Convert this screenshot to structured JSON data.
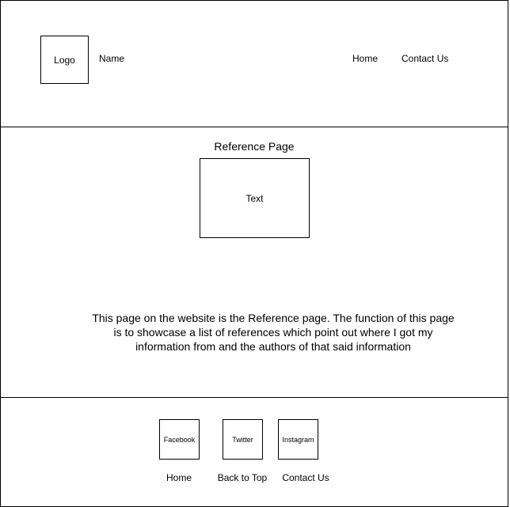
{
  "header": {
    "logo_label": "Logo",
    "site_name": "Name",
    "nav": {
      "home": "Home",
      "contact": "Contact Us"
    }
  },
  "main": {
    "title": "Reference Page",
    "text_box_label": "Text",
    "description": "This page on the website is the Reference page. The function of this page is to showcase a list of references which point out where I got my information from and the authors of that said information"
  },
  "footer": {
    "social": {
      "facebook": "Facebook",
      "twitter": "Twitter",
      "instagram": "Instagram"
    },
    "links": {
      "home": "Home",
      "back_to_top": "Back to Top",
      "contact": "Contact Us"
    }
  }
}
